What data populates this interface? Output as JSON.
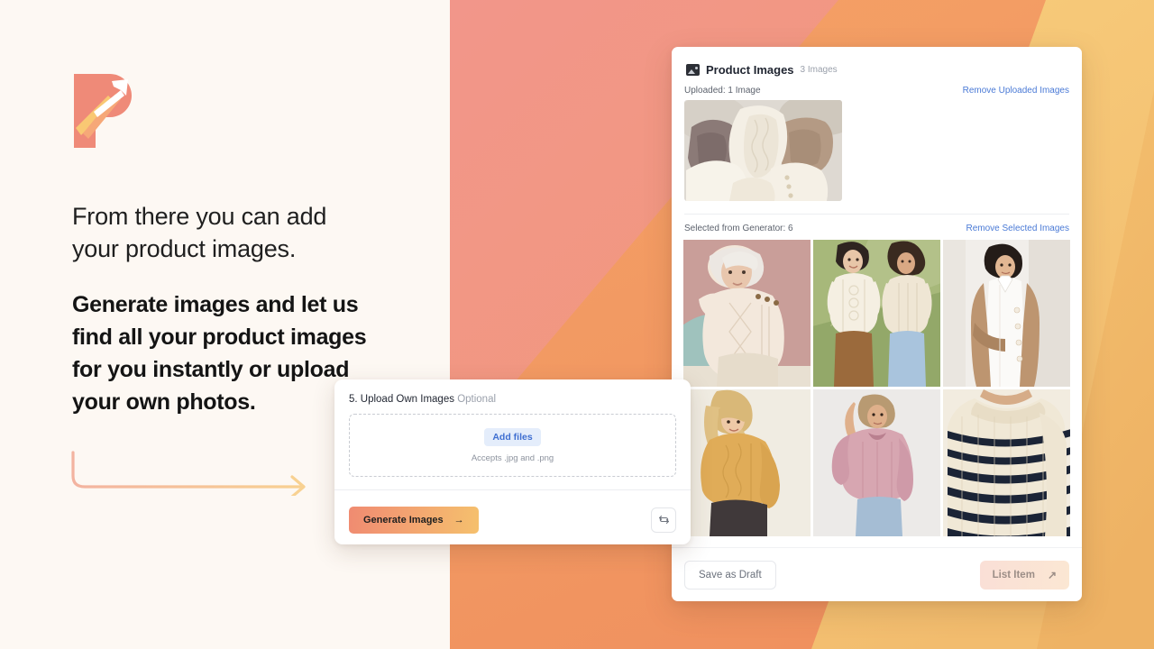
{
  "background": {
    "left_panel_color": "#fdf8f3",
    "band_salmon": "#f0907f",
    "band_coral": "#f2a068",
    "band_orange": "#f59f62",
    "band_gold": "#f6c66e",
    "band_yellow": "#f7cf77"
  },
  "brand": {
    "logo_name": "p-arrow-logo",
    "logo_colors": [
      "#ef8a78",
      "#f4a96f",
      "#f8c46f"
    ]
  },
  "marketing": {
    "headline": "From there you can add your product images.",
    "subheadline": "Generate images and let us find all your product images for you instantly or upload your own photos.",
    "arrow_name": "curved-arrow-graphic"
  },
  "upload_card": {
    "step_title": "5. Upload Own Images",
    "optional_label": "Optional",
    "add_files_label": "Add files",
    "accepts_text": "Accepts .jpg and .png",
    "generate_label": "Generate Images",
    "generate_arrow": "→",
    "refresh_icon": "refresh-icon",
    "add_files_bg": "#e4edfb",
    "add_files_color": "#3f6fd1",
    "generate_gradient_from": "#f08b71",
    "generate_gradient_to": "#f5c06d"
  },
  "product_panel": {
    "icon": "image-icon",
    "title": "Product Images",
    "count_label": "3 Images",
    "uploaded": {
      "label": "Uploaded: 1 Image",
      "remove_link": "Remove Uploaded Images",
      "thumbnails": [
        {
          "name": "flat-lay-knit-sweaters",
          "alt": "Flat lay of cream, brown and taupe knit sweaters"
        }
      ]
    },
    "selected": {
      "label": "Selected from Generator: 6",
      "remove_link": "Remove Selected Images",
      "thumbnails": [
        {
          "name": "model-cream-cable-sweater-pink-bg",
          "alt": "Blonde woman in cream cable knit sweater on pink background"
        },
        {
          "name": "two-models-cream-sweaters-green-bg",
          "alt": "Two models in cream cable sweaters on green background"
        },
        {
          "name": "model-tan-cardigan-white-bg",
          "alt": "Model in tan cardigan over white shirt dress"
        },
        {
          "name": "model-mustard-sweater",
          "alt": "Blonde model in mustard cable sweater with black jeans"
        },
        {
          "name": "model-pink-sweater",
          "alt": "Model in dusty pink oversized sweater"
        },
        {
          "name": "striped-cream-navy-sweater",
          "alt": "Close up of cream sweater with navy stripes"
        }
      ]
    },
    "footer": {
      "save_draft_label": "Save as Draft",
      "list_item_label": "List Item",
      "list_item_arrow": "↗",
      "link_color": "#4a7ad6"
    }
  }
}
